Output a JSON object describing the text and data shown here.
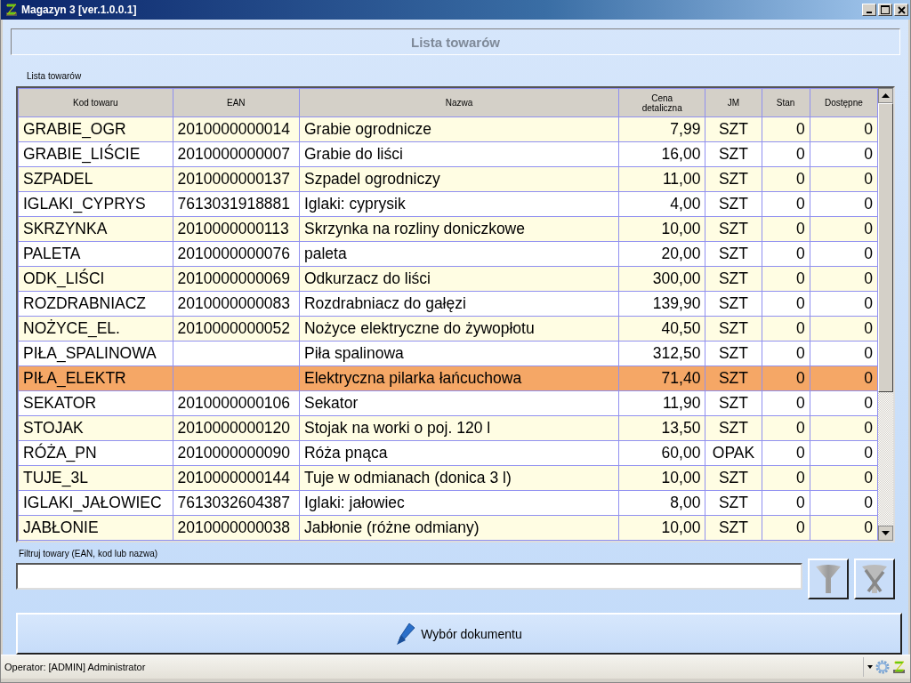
{
  "window": {
    "title": "Magazyn 3 [ver.1.0.0.1]"
  },
  "header": {
    "title": "Lista towarów"
  },
  "table": {
    "label": "Lista towarów",
    "columns": [
      "Kod towaru",
      "EAN",
      "Nazwa",
      "Cena detaliczna",
      "JM",
      "Stan",
      "Dostępne"
    ],
    "rows": [
      {
        "cells": [
          "GRABIE_OGR",
          "2010000000014",
          "Grabie ogrodnicze",
          "7,99",
          "SZT",
          "0",
          "0"
        ],
        "selected": false
      },
      {
        "cells": [
          "GRABIE_LIŚCIE",
          "2010000000007",
          "Grabie do liści",
          "16,00",
          "SZT",
          "0",
          "0"
        ],
        "selected": false
      },
      {
        "cells": [
          "SZPADEL",
          "2010000000137",
          "Szpadel ogrodniczy",
          "11,00",
          "SZT",
          "0",
          "0"
        ],
        "selected": false
      },
      {
        "cells": [
          "IGLAKI_CYPRYS",
          "7613031918881",
          "Iglaki: cyprysik",
          "4,00",
          "SZT",
          "0",
          "0"
        ],
        "selected": false
      },
      {
        "cells": [
          "SKRZYNKA",
          "2010000000113",
          "Skrzynka na rozliny doniczkowe",
          "10,00",
          "SZT",
          "0",
          "0"
        ],
        "selected": false
      },
      {
        "cells": [
          "PALETA",
          "2010000000076",
          "paleta",
          "20,00",
          "SZT",
          "0",
          "0"
        ],
        "selected": false
      },
      {
        "cells": [
          "ODK_LIŚCI",
          "2010000000069",
          "Odkurzacz do liści",
          "300,00",
          "SZT",
          "0",
          "0"
        ],
        "selected": false
      },
      {
        "cells": [
          "ROZDRABNIACZ",
          "2010000000083",
          "Rozdrabniacz do gałęzi",
          "139,90",
          "SZT",
          "0",
          "0"
        ],
        "selected": false
      },
      {
        "cells": [
          "NOŻYCE_EL.",
          "2010000000052",
          "Nożyce elektryczne do żywopłotu",
          "40,50",
          "SZT",
          "0",
          "0"
        ],
        "selected": false
      },
      {
        "cells": [
          "PIŁA_SPALINOWA",
          "",
          "Piła spalinowa",
          "312,50",
          "SZT",
          "0",
          "0"
        ],
        "selected": false
      },
      {
        "cells": [
          "PIŁA_ELEKTR",
          "",
          "Elektryczna pilarka łańcuchowa",
          "71,40",
          "SZT",
          "0",
          "0"
        ],
        "selected": true
      },
      {
        "cells": [
          "SEKATOR",
          "2010000000106",
          "Sekator",
          "11,90",
          "SZT",
          "0",
          "0"
        ],
        "selected": false
      },
      {
        "cells": [
          "STOJAK",
          "2010000000120",
          "Stojak na worki o poj. 120 l",
          "13,50",
          "SZT",
          "0",
          "0"
        ],
        "selected": false
      },
      {
        "cells": [
          "RÓŻA_PN",
          "2010000000090",
          "Róża pnąca",
          "60,00",
          "OPAK",
          "0",
          "0"
        ],
        "selected": false
      },
      {
        "cells": [
          "TUJE_3L",
          "2010000000144",
          "Tuje w odmianach (donica 3 l)",
          "10,00",
          "SZT",
          "0",
          "0"
        ],
        "selected": false
      },
      {
        "cells": [
          "IGLAKI_JAŁOWIEC",
          "7613032604387",
          "Iglaki: jałowiec",
          "8,00",
          "SZT",
          "0",
          "0"
        ],
        "selected": false
      },
      {
        "cells": [
          "JABŁONIE",
          "2010000000038",
          "Jabłonie (różne odmiany)",
          "10,00",
          "SZT",
          "0",
          "0"
        ],
        "selected": false
      }
    ]
  },
  "filter": {
    "label": "Filtruj towary (EAN, kod lub nazwa)"
  },
  "document_button": {
    "label": "Wybór dokumentu"
  },
  "status_bar": {
    "text": "Operator: [ADMIN] Administrator"
  }
}
